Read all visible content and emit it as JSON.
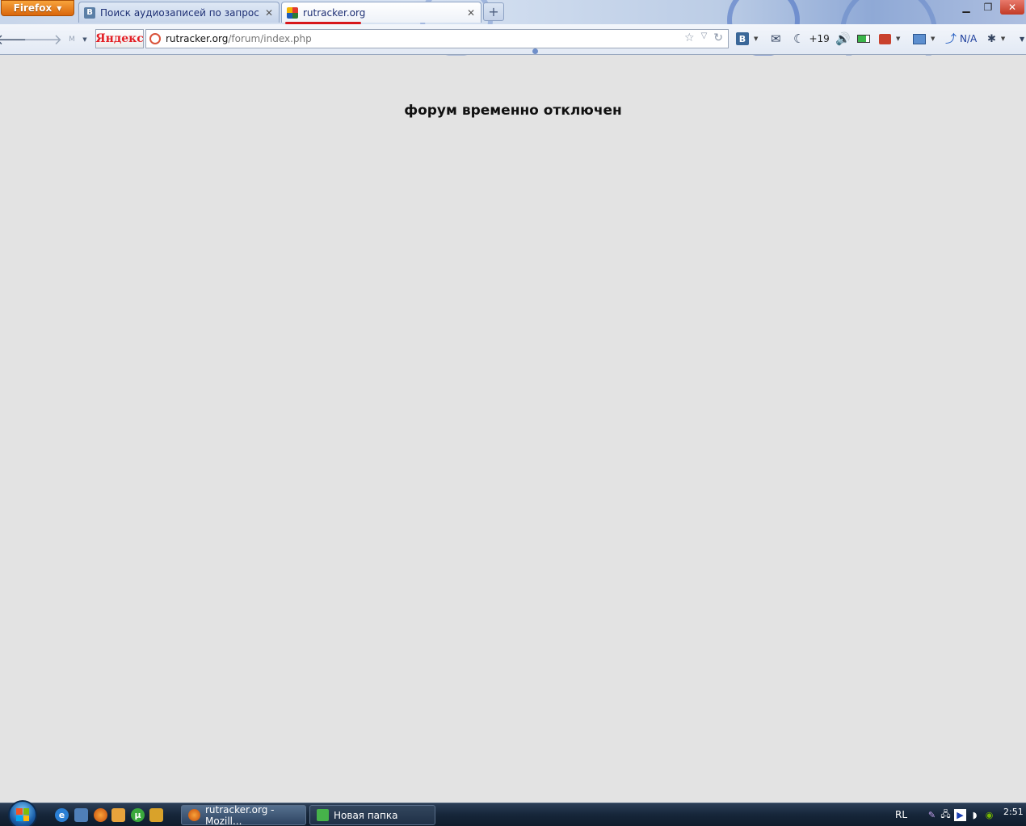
{
  "browser": {
    "menu_button": "Firefox",
    "tabs": [
      {
        "label": "Поиск аудиозаписей по запросу ме...",
        "favicon": "B",
        "active": false
      },
      {
        "label": "rutracker.org",
        "active": true
      }
    ],
    "search_engine_label": "Яндекс",
    "url": {
      "host": "rutracker.org",
      "path": "/forum/index.php"
    },
    "toolbar": {
      "vk_label": "B",
      "notification_count": "+19",
      "weather_label": "N/A"
    }
  },
  "page": {
    "message": "форум временно отключен"
  },
  "taskbar": {
    "items": [
      {
        "label": "rutracker.org - Mozill..."
      },
      {
        "label": "Новая папка"
      }
    ],
    "language": "RL",
    "clock": "2:51"
  },
  "colors": {
    "page_background": "#e3e3e3",
    "tab_underline": "#d7161b",
    "firefox_button": "#e8811e",
    "vk_blue": "#3a6798"
  }
}
